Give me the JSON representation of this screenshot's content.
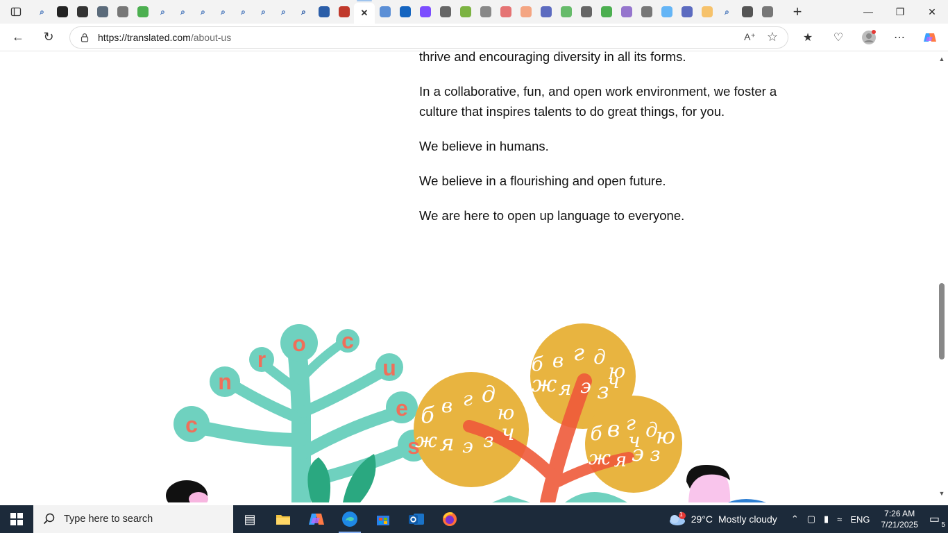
{
  "browser": {
    "url_host": "https://translated.com",
    "url_path": "/about-us",
    "tabs": [
      {
        "icon": "search-icon",
        "color": "#3b6db7"
      },
      {
        "icon": "openai-icon",
        "color": "#222222"
      },
      {
        "icon": "bing-icon",
        "color": "#333333"
      },
      {
        "icon": "writing-icon",
        "color": "#5b6b7b"
      },
      {
        "icon": "notion-icon",
        "color": "#777777"
      },
      {
        "icon": "maps-icon",
        "color": "#4caf50"
      },
      {
        "icon": "search-icon",
        "color": "#3b6db7"
      },
      {
        "icon": "search-icon",
        "color": "#3b6db7"
      },
      {
        "icon": "search-icon",
        "color": "#3b6db7"
      },
      {
        "icon": "search-icon",
        "color": "#3b6db7"
      },
      {
        "icon": "search-icon",
        "color": "#3b6db7"
      },
      {
        "icon": "search-icon",
        "color": "#3b6db7"
      },
      {
        "icon": "search-icon",
        "color": "#3b6db7"
      },
      {
        "icon": "search-icon",
        "color": "#1a4fa0"
      },
      {
        "icon": "script-icon",
        "color": "#2b5ea8"
      },
      {
        "icon": "shield-icon",
        "color": "#c0392b"
      },
      {
        "icon": "close-icon",
        "color": "#333333",
        "active": true
      },
      {
        "icon": "blue-circle-icon",
        "color": "#5b8fd6"
      },
      {
        "icon": "xf-icon",
        "color": "#1565c0"
      },
      {
        "icon": "e-icon",
        "color": "#7c4dff"
      },
      {
        "icon": "robot-icon",
        "color": "#666666"
      },
      {
        "icon": "c-icon",
        "color": "#7cb342"
      },
      {
        "icon": "gear-icon",
        "color": "#888888"
      },
      {
        "icon": "loop-icon",
        "color": "#e57373"
      },
      {
        "icon": "dots-icon",
        "color": "#f4a582"
      },
      {
        "icon": "wave-icon",
        "color": "#5c6bc0"
      },
      {
        "icon": "g-icon",
        "color": "#66bb6a"
      },
      {
        "icon": "robot-icon",
        "color": "#666666"
      },
      {
        "icon": "leaf-icon",
        "color": "#4caf50"
      },
      {
        "icon": "square-icon",
        "color": "#9575cd"
      },
      {
        "icon": "spiral-icon",
        "color": "#777777"
      },
      {
        "icon": "ring-icon",
        "color": "#64b5f6"
      },
      {
        "icon": "asterisk-icon",
        "color": "#5c6bc0"
      },
      {
        "icon": "note-icon",
        "color": "#f6c26b"
      },
      {
        "icon": "search-icon",
        "color": "#3b6db7"
      },
      {
        "icon": "layers-icon",
        "color": "#555555"
      },
      {
        "icon": "globe-icon",
        "color": "#777777"
      }
    ]
  },
  "page": {
    "paragraphs": [
      "thrive and encouraging diversity in all its forms.",
      "In a collaborative, fun, and open work environment, we foster a culture that inspires talents to do great things, for you.",
      "We believe in humans.",
      "We believe in a flourishing and open future.",
      "We are here to open up language to everyone."
    ],
    "tree_letters": [
      "c",
      "n",
      "r",
      "o",
      "c",
      "u",
      "e",
      "s"
    ],
    "cyrillic_glyphs": [
      "б",
      "в",
      "г",
      "д",
      "ю",
      "ж",
      "я",
      "э",
      "з",
      "ч"
    ]
  },
  "taskbar": {
    "search_placeholder": "Type here to search",
    "weather_badge": "1",
    "temperature": "29°C",
    "weather_text": "Mostly cloudy",
    "language": "ENG",
    "time": "7:26 AM",
    "date": "7/21/2025",
    "notification_count": "5"
  },
  "colors": {
    "tree_teal": "#6fd1bf",
    "leaf_green": "#2aa880",
    "letter_coral": "#ef6f5a",
    "ochre": "#e8b440",
    "trunk_red": "#ef5a3a"
  }
}
